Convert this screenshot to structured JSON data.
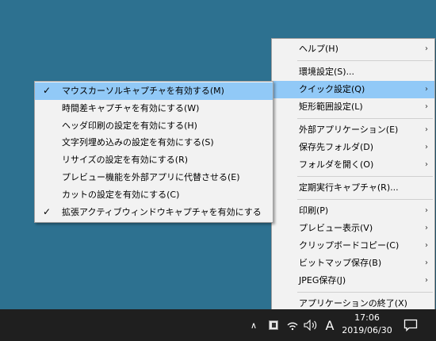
{
  "main_menu": {
    "groups": [
      [
        {
          "label": "ヘルプ(H)",
          "submenu": true
        }
      ],
      [
        {
          "label": "環境設定(S)...",
          "submenu": false
        },
        {
          "label": "クイック設定(Q)",
          "submenu": true,
          "highlighted": true
        },
        {
          "label": "矩形範囲設定(L)",
          "submenu": true
        }
      ],
      [
        {
          "label": "外部アプリケーション(E)",
          "submenu": true
        },
        {
          "label": "保存先フォルダ(D)",
          "submenu": true
        },
        {
          "label": "フォルダを開く(O)",
          "submenu": true
        }
      ],
      [
        {
          "label": "定期実行キャプチャ(R)...",
          "submenu": false
        }
      ],
      [
        {
          "label": "印刷(P)",
          "submenu": true
        },
        {
          "label": "プレビュー表示(V)",
          "submenu": true
        },
        {
          "label": "クリップボードコピー(C)",
          "submenu": true
        },
        {
          "label": "ビットマップ保存(B)",
          "submenu": true
        },
        {
          "label": "JPEG保存(J)",
          "submenu": true
        }
      ],
      [
        {
          "label": "アプリケーションの終了(X)",
          "submenu": false
        }
      ]
    ]
  },
  "quick_settings_menu": {
    "items": [
      {
        "label": "マウスカーソルキャプチャを有効する(M)",
        "checked": true,
        "highlighted": true
      },
      {
        "label": "時間差キャプチャを有効にする(W)",
        "checked": false
      },
      {
        "label": "ヘッダ印刷の設定を有効にする(H)",
        "checked": false
      },
      {
        "label": "文字列埋め込みの設定を有効にする(S)",
        "checked": false
      },
      {
        "label": "リサイズの設定を有効にする(R)",
        "checked": false
      },
      {
        "label": "プレビュー機能を外部アプリに代替させる(E)",
        "checked": false
      },
      {
        "label": "カットの設定を有効にする(C)",
        "checked": false
      },
      {
        "label": "拡張アクティブウィンドウキャプチャを有効にする",
        "checked": true
      }
    ]
  },
  "glyphs": {
    "arrow": "›",
    "check": "✓"
  },
  "taskbar": {
    "chevron": "∧",
    "wifi": "((·",
    "volume": "🔈",
    "ime": "A",
    "time": "17:06",
    "date": "2019/06/30"
  },
  "colors": {
    "desktop": "#2d7190",
    "menu_bg": "#f2f2f2",
    "highlight": "#91c9f7",
    "taskbar": "#1f1f1f"
  }
}
